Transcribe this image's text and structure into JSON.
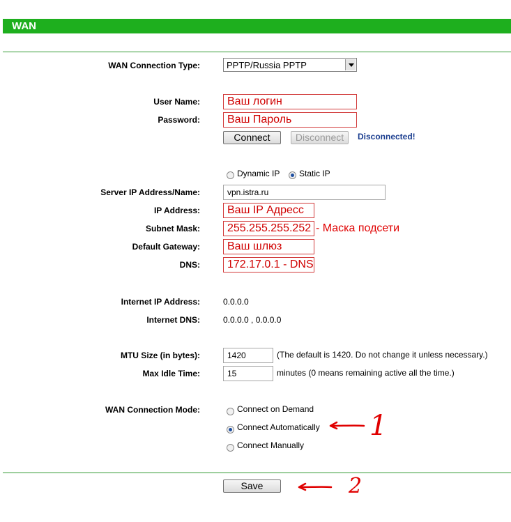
{
  "header": {
    "title": "WAN"
  },
  "connection_type": {
    "label": "WAN Connection Type:",
    "selected": "PPTP/Russia PPTP"
  },
  "account": {
    "user_label": "User Name:",
    "user_value": "Ваш логин",
    "password_label": "Password:",
    "password_value": "Ваш Пароль",
    "connect_button": "Connect",
    "disconnect_button": "Disconnect",
    "status": "Disconnected!"
  },
  "ip_mode": {
    "dynamic_label": "Dynamic IP",
    "static_label": "Static IP",
    "selected": "Static IP"
  },
  "static": {
    "server_label": "Server IP Address/Name:",
    "server_value": "vpn.istra.ru",
    "ip_label": "IP Address:",
    "ip_value": "Ваш IP Адресс",
    "mask_label": "Subnet Mask:",
    "mask_value": "255.255.255.252",
    "mask_note": "- Маска подсети",
    "gateway_label": "Default Gateway:",
    "gateway_value": "Ваш шлюз",
    "dns_label": "DNS:",
    "dns_value": "172.17.0.1 - DNS"
  },
  "internet": {
    "ip_label": "Internet IP Address:",
    "ip_value": "0.0.0.0",
    "dns_label": "Internet DNS:",
    "dns_value": "0.0.0.0 , 0.0.0.0"
  },
  "mtu": {
    "label": "MTU Size (in bytes):",
    "value": "1420",
    "hint": "(The default is 1420. Do not change it unless necessary.)"
  },
  "idle": {
    "label": "Max Idle Time:",
    "value": "15",
    "hint": "minutes (0 means remaining active all the time.)"
  },
  "mode": {
    "label": "WAN Connection Mode:",
    "options": [
      "Connect on Demand",
      "Connect Automatically",
      "Connect Manually"
    ],
    "selected": "Connect Automatically"
  },
  "save_button": "Save",
  "annotations": {
    "step1": "1",
    "step2": "2"
  },
  "colors": {
    "header_green": "#1eaf1e",
    "annotation_red": "#e00000",
    "status_blue": "#1a3d8f"
  }
}
